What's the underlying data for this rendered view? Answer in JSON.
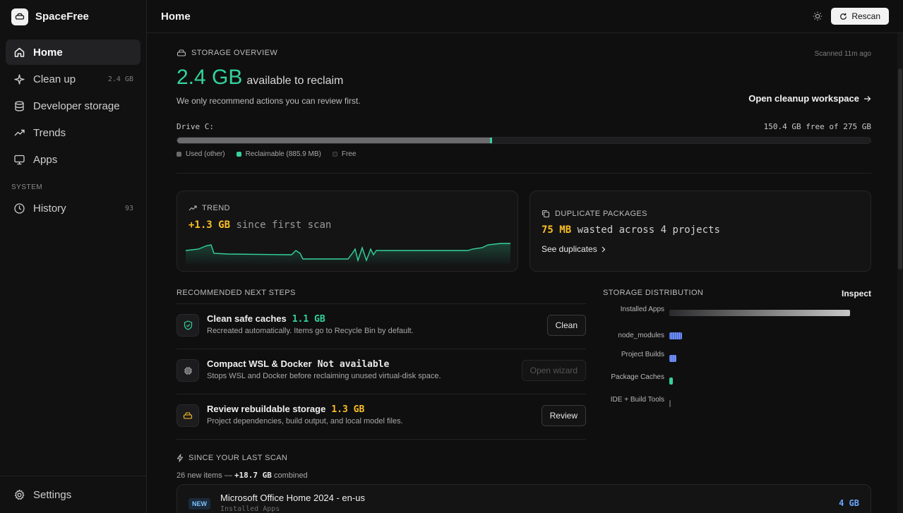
{
  "app": {
    "name": "SpaceFree"
  },
  "sidebar": {
    "items": [
      {
        "label": "Home",
        "icon": "home-icon",
        "badge": ""
      },
      {
        "label": "Clean up",
        "icon": "sparkle-icon",
        "badge": "2.4 GB"
      },
      {
        "label": "Developer storage",
        "icon": "database-icon",
        "badge": ""
      },
      {
        "label": "Trends",
        "icon": "trend-icon",
        "badge": ""
      },
      {
        "label": "Apps",
        "icon": "monitor-icon",
        "badge": ""
      }
    ],
    "section_label": "SYSTEM",
    "history": {
      "label": "History",
      "badge": "93"
    },
    "settings_label": "Settings"
  },
  "header": {
    "title": "Home",
    "rescan_label": "Rescan",
    "theme_icon": "sun-icon"
  },
  "overview": {
    "heading": "STORAGE OVERVIEW",
    "scanned": "Scanned 11m ago",
    "reclaim_value": "2.4 GB",
    "reclaim_text": "available to reclaim",
    "subtitle": "We only recommend actions you can review first.",
    "open_workspace": "Open cleanup workspace",
    "drive_label": "Drive C:",
    "drive_free": "150.4 GB free of 275 GB",
    "used_fraction": 0.451,
    "reclaimable_fraction": 0.0032,
    "legend": {
      "used": "Used (other)",
      "reclaimable": "Reclaimable (885.9 MB)",
      "free": "Free"
    },
    "colors": {
      "used": "#6b6b6e",
      "reclaimable": "#34d399",
      "free": "#1e1e20"
    }
  },
  "trend": {
    "heading": "TREND",
    "value": "+1.3 GB",
    "text": "since first scan"
  },
  "duplicates": {
    "heading": "DUPLICATE PACKAGES",
    "value": "75 MB",
    "text": "wasted across 4 projects",
    "link": "See duplicates"
  },
  "recommended": {
    "heading": "RECOMMENDED NEXT STEPS",
    "steps": [
      {
        "title": "Clean safe caches",
        "size": "1.1 GB",
        "desc": "Recreated automatically. Items go to Recycle Bin by default.",
        "button": "Clean",
        "icon": "shield-icon"
      },
      {
        "title": "Compact WSL & Docker",
        "size": "Not available",
        "desc": "Stops WSL and Docker before reclaiming unused virtual-disk space.",
        "button": "Open wizard",
        "icon": "chip-icon"
      },
      {
        "title": "Review rebuildable storage",
        "size": "1.3 GB",
        "desc": "Project dependencies, build output, and local model files.",
        "button": "Review",
        "icon": "drive-icon"
      }
    ]
  },
  "distribution": {
    "heading": "STORAGE DISTRIBUTION",
    "inspect": "Inspect",
    "rows": [
      {
        "label": "Installed Apps",
        "fraction": 1.0,
        "color": "#9a9a9a"
      },
      {
        "label": "node_modules",
        "fraction": 0.07,
        "color": "#4f6fd6"
      },
      {
        "label": "Project Builds",
        "fraction": 0.04,
        "color": "#5b7be0"
      },
      {
        "label": "Package Caches",
        "fraction": 0.02,
        "color": "#34d399"
      },
      {
        "label": "IDE + Build Tools",
        "fraction": 0.005,
        "color": "#555555"
      }
    ]
  },
  "since_scan": {
    "heading": "SINCE YOUR LAST SCAN",
    "count_text": "26 new items —",
    "combined_value": "+18.7 GB",
    "combined_text": "combined",
    "items": [
      {
        "badge": "NEW",
        "name": "Microsoft Office Home 2024 - en-us",
        "category": "Installed Apps",
        "size": "4 GB"
      }
    ]
  }
}
